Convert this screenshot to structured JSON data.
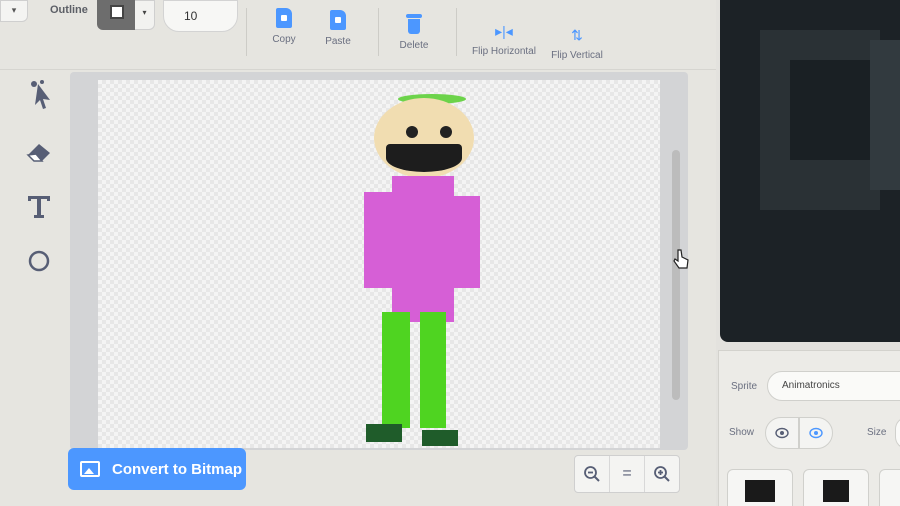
{
  "toolbar": {
    "outline_label": "Outline",
    "outline_width": "10",
    "copy_label": "Copy",
    "paste_label": "Paste",
    "delete_label": "Delete",
    "flip_h_label": "Flip Horizontal",
    "flip_v_label": "Flip Vertical",
    "accent": "#4c97ff"
  },
  "tools": [
    {
      "icon": "reshape-icon"
    },
    {
      "icon": "eraser-icon"
    },
    {
      "icon": "text-icon"
    },
    {
      "icon": "circle-icon"
    }
  ],
  "footer": {
    "convert_label": "Convert to Bitmap",
    "zoom_out_icon": "zoom-out-icon",
    "zoom_reset_label": "=",
    "zoom_in_icon": "zoom-in-icon"
  },
  "sprite_info": {
    "sprite_label": "Sprite",
    "sprite_name": "Animatronics",
    "show_label": "Show",
    "size_label": "Size"
  },
  "character_colors": {
    "hat": "#6cd34a",
    "face": "#f1ddb1",
    "mouth": "#1d1d1d",
    "shirt": "#d65fd6",
    "pants": "#4fd421",
    "shoes": "#1f5c2a"
  }
}
